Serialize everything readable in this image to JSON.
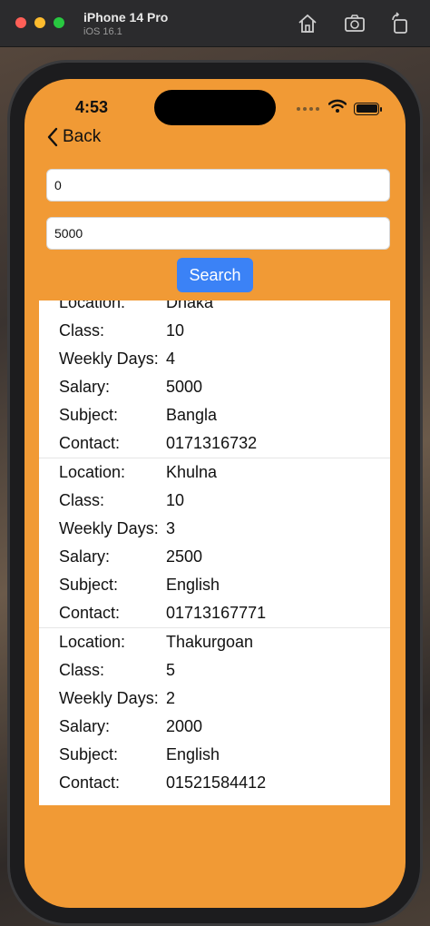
{
  "window": {
    "title": "iPhone 14 Pro",
    "subtitle": "iOS 16.1"
  },
  "status_bar": {
    "time": "4:53"
  },
  "nav": {
    "back_label": "Back"
  },
  "filters": {
    "min_value": "0",
    "max_value": "5000",
    "search_label": "Search"
  },
  "labels": {
    "location": "Location:",
    "class": "Class:",
    "weekly_days": "Weekly Days:",
    "salary": "Salary:",
    "subject": "Subject:",
    "contact": "Contact:"
  },
  "results": [
    {
      "location": "Dhaka",
      "class": "10",
      "weekly_days": "4",
      "salary": "5000",
      "subject": "Bangla",
      "contact": "0171316732"
    },
    {
      "location": "Khulna",
      "class": "10",
      "weekly_days": "3",
      "salary": "2500",
      "subject": "English",
      "contact": "01713167771"
    },
    {
      "location": "Thakurgoan",
      "class": "5",
      "weekly_days": "2",
      "salary": "2000",
      "subject": "English",
      "contact": "01521584412"
    }
  ],
  "colors": {
    "screen_bg": "#f19a35",
    "button_bg": "#3b82f6"
  }
}
